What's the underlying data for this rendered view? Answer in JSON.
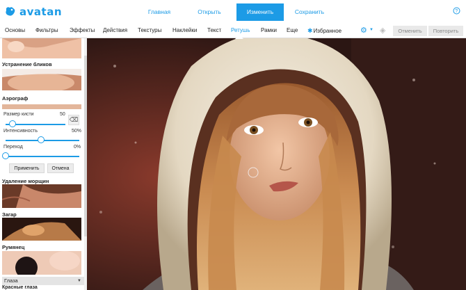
{
  "app": {
    "logo_text": "avatan"
  },
  "top_nav": [
    {
      "label": "Главная",
      "active": false
    },
    {
      "label": "Открыть",
      "active": false
    },
    {
      "label": "Изменить",
      "active": true
    },
    {
      "label": "Сохранить",
      "active": false
    }
  ],
  "toolbar": {
    "tools": [
      "Основы",
      "Фильтры",
      "Эффекты",
      "Действия",
      "Текстуры",
      "Наклейки",
      "Текст",
      "Ретушь",
      "Рамки",
      "Еще",
      "Избранное"
    ],
    "active_tool": "Ретушь",
    "undo_label": "Отменить",
    "redo_label": "Повторить"
  },
  "sidebar": {
    "glare_label": "Устранение бликов",
    "airbrush_label": "Аэрограф",
    "brush_size_label": "Размер кисти",
    "brush_size_value": "50",
    "intensity_label": "Интенсивность",
    "intensity_value": "50%",
    "transition_label": "Переход",
    "transition_value": "0%",
    "apply_label": "Применить",
    "cancel_label": "Отмена",
    "wrinkles_label": "Удаление морщин",
    "tan_label": "Загар",
    "blush_label": "Румянец",
    "eyes_dropdown": "Глаза",
    "red_eyes_label": "Красные глаза"
  },
  "sliders": {
    "brush_size": 0.12,
    "intensity": 0.48,
    "transition": 0.0
  },
  "colors": {
    "accent": "#1c9be6",
    "undo_bg": "#e9e9e9"
  }
}
